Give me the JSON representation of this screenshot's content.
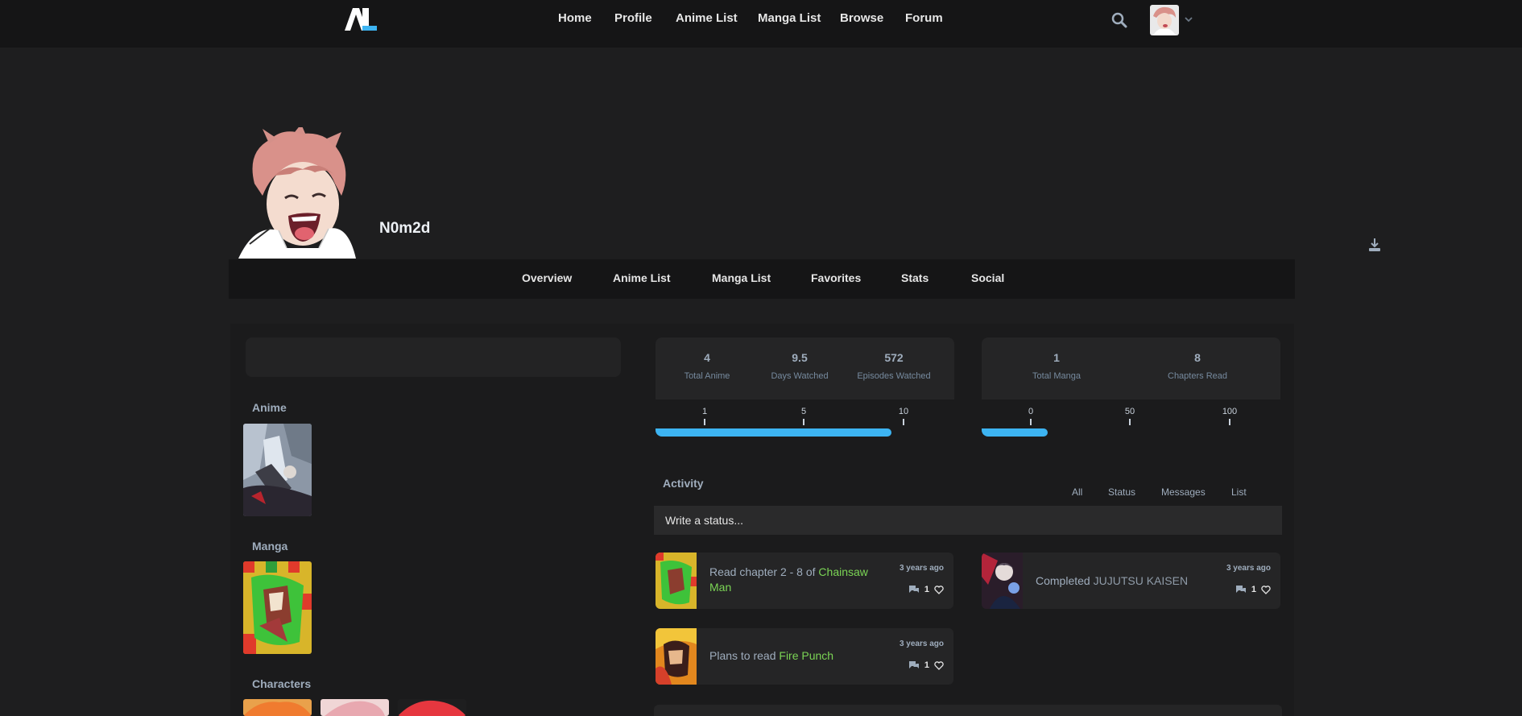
{
  "topnav": {
    "logo_text": "AL",
    "links": [
      "Home",
      "Profile",
      "Anime List",
      "Manga List",
      "Browse",
      "Forum"
    ]
  },
  "profile": {
    "username": "N0m2d",
    "tabs": [
      "Overview",
      "Anime List",
      "Manga List",
      "Favorites",
      "Stats",
      "Social"
    ]
  },
  "favourites": {
    "anime_title": "Anime",
    "manga_title": "Manga",
    "characters_title": "Characters"
  },
  "anime_stats": {
    "items": [
      {
        "value": "4",
        "label": "Total Anime"
      },
      {
        "value": "9.5",
        "label": "Days Watched"
      },
      {
        "value": "572",
        "label": "Episodes Watched"
      }
    ],
    "ticks": [
      "1",
      "5",
      "10"
    ],
    "progress": 0.79
  },
  "manga_stats": {
    "items": [
      {
        "value": "1",
        "label": "Total Manga"
      },
      {
        "value": "8",
        "label": "Chapters Read"
      }
    ],
    "ticks": [
      "0",
      "50",
      "100"
    ],
    "progress": 0.22
  },
  "activity": {
    "title": "Activity",
    "filters": [
      "All",
      "Status",
      "Messages",
      "List"
    ],
    "status_placeholder": "Write a status...",
    "items": [
      {
        "prefix": "Read chapter 2 - 8 of ",
        "media": "Chainsaw Man",
        "time": "3 years ago",
        "likes": "1"
      },
      {
        "prefix": "Completed ",
        "media": "JUJUTSU KAISEN",
        "time": "3 years ago",
        "likes": "1"
      },
      {
        "prefix": "Plans to read ",
        "media": "Fire Punch",
        "time": "3 years ago",
        "likes": "1"
      }
    ]
  },
  "colors": {
    "accent_blue": "#3db4f2",
    "media_green": "#7bd555",
    "background": "#1e1e1f"
  }
}
